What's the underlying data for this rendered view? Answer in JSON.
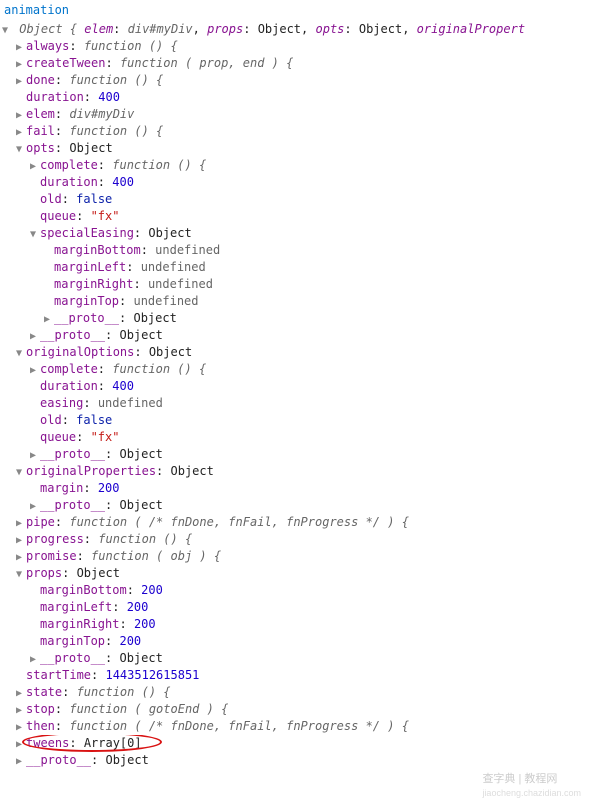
{
  "title": "animation",
  "summary": {
    "prefix": "Object {",
    "pairs": [
      {
        "k": "elem",
        "v": "div#myDiv",
        "cls": "ref"
      },
      {
        "k": "props",
        "v": "Object",
        "cls": "obj-inline"
      },
      {
        "k": "opts",
        "v": "Object",
        "cls": "obj-inline"
      },
      {
        "k": "originalPropert",
        "v": "",
        "cls": "obj-inline"
      }
    ]
  },
  "rows": [
    {
      "d": 1,
      "a": "r",
      "k": "always",
      "v": "function () {",
      "t": "fn"
    },
    {
      "d": 1,
      "a": "r",
      "k": "createTween",
      "v": "function ( prop, end ) {",
      "t": "fn"
    },
    {
      "d": 1,
      "a": "r",
      "k": "done",
      "v": "function () {",
      "t": "fn"
    },
    {
      "d": 1,
      "a": "n",
      "k": "duration",
      "v": "400",
      "t": "num"
    },
    {
      "d": 1,
      "a": "r",
      "k": "elem",
      "v": "div#myDiv",
      "t": "ref"
    },
    {
      "d": 1,
      "a": "r",
      "k": "fail",
      "v": "function () {",
      "t": "fn"
    },
    {
      "d": 1,
      "a": "d",
      "k": "opts",
      "v": "Object",
      "t": "obj"
    },
    {
      "d": 2,
      "a": "r",
      "k": "complete",
      "v": "function () {",
      "t": "fn"
    },
    {
      "d": 2,
      "a": "n",
      "k": "duration",
      "v": "400",
      "t": "num"
    },
    {
      "d": 2,
      "a": "n",
      "k": "old",
      "v": "false",
      "t": "bool"
    },
    {
      "d": 2,
      "a": "n",
      "k": "queue",
      "v": "\"fx\"",
      "t": "str"
    },
    {
      "d": 2,
      "a": "d",
      "k": "specialEasing",
      "v": "Object",
      "t": "obj"
    },
    {
      "d": 3,
      "a": "n",
      "k": "marginBottom",
      "v": "undefined",
      "t": "undef"
    },
    {
      "d": 3,
      "a": "n",
      "k": "marginLeft",
      "v": "undefined",
      "t": "undef"
    },
    {
      "d": 3,
      "a": "n",
      "k": "marginRight",
      "v": "undefined",
      "t": "undef"
    },
    {
      "d": 3,
      "a": "n",
      "k": "marginTop",
      "v": "undefined",
      "t": "undef"
    },
    {
      "d": 3,
      "a": "r",
      "k": "__proto__",
      "v": "Object",
      "t": "obj"
    },
    {
      "d": 2,
      "a": "r",
      "k": "__proto__",
      "v": "Object",
      "t": "obj"
    },
    {
      "d": 1,
      "a": "d",
      "k": "originalOptions",
      "v": "Object",
      "t": "obj"
    },
    {
      "d": 2,
      "a": "r",
      "k": "complete",
      "v": "function () {",
      "t": "fn"
    },
    {
      "d": 2,
      "a": "n",
      "k": "duration",
      "v": "400",
      "t": "num"
    },
    {
      "d": 2,
      "a": "n",
      "k": "easing",
      "v": "undefined",
      "t": "undef"
    },
    {
      "d": 2,
      "a": "n",
      "k": "old",
      "v": "false",
      "t": "bool"
    },
    {
      "d": 2,
      "a": "n",
      "k": "queue",
      "v": "\"fx\"",
      "t": "str"
    },
    {
      "d": 2,
      "a": "r",
      "k": "__proto__",
      "v": "Object",
      "t": "obj"
    },
    {
      "d": 1,
      "a": "d",
      "k": "originalProperties",
      "v": "Object",
      "t": "obj"
    },
    {
      "d": 2,
      "a": "n",
      "k": "margin",
      "v": "200",
      "t": "num"
    },
    {
      "d": 2,
      "a": "r",
      "k": "__proto__",
      "v": "Object",
      "t": "obj"
    },
    {
      "d": 1,
      "a": "r",
      "k": "pipe",
      "v": "function ( /* fnDone, fnFail, fnProgress */ ) {",
      "t": "fn"
    },
    {
      "d": 1,
      "a": "r",
      "k": "progress",
      "v": "function () {",
      "t": "fn"
    },
    {
      "d": 1,
      "a": "r",
      "k": "promise",
      "v": "function ( obj ) {",
      "t": "fn"
    },
    {
      "d": 1,
      "a": "d",
      "k": "props",
      "v": "Object",
      "t": "obj"
    },
    {
      "d": 2,
      "a": "n",
      "k": "marginBottom",
      "v": "200",
      "t": "num"
    },
    {
      "d": 2,
      "a": "n",
      "k": "marginLeft",
      "v": "200",
      "t": "num"
    },
    {
      "d": 2,
      "a": "n",
      "k": "marginRight",
      "v": "200",
      "t": "num"
    },
    {
      "d": 2,
      "a": "n",
      "k": "marginTop",
      "v": "200",
      "t": "num"
    },
    {
      "d": 2,
      "a": "r",
      "k": "__proto__",
      "v": "Object",
      "t": "obj"
    },
    {
      "d": 1,
      "a": "n",
      "k": "startTime",
      "v": "1443512615851",
      "t": "num"
    },
    {
      "d": 1,
      "a": "r",
      "k": "state",
      "v": "function () {",
      "t": "fn"
    },
    {
      "d": 1,
      "a": "r",
      "k": "stop",
      "v": "function ( gotoEnd ) {",
      "t": "fn"
    },
    {
      "d": 1,
      "a": "r",
      "k": "then",
      "v": "function ( /* fnDone, fnFail, fnProgress */ ) {",
      "t": "fn"
    },
    {
      "d": 1,
      "a": "r",
      "k": "tweens",
      "v": "Array[0]",
      "t": "obj",
      "circle": true
    },
    {
      "d": 1,
      "a": "r",
      "k": "__proto__",
      "v": "Object",
      "t": "obj"
    }
  ],
  "watermark": {
    "line1": "查字典 | 教程网",
    "line2": "jiaocheng.chazidian.com"
  }
}
